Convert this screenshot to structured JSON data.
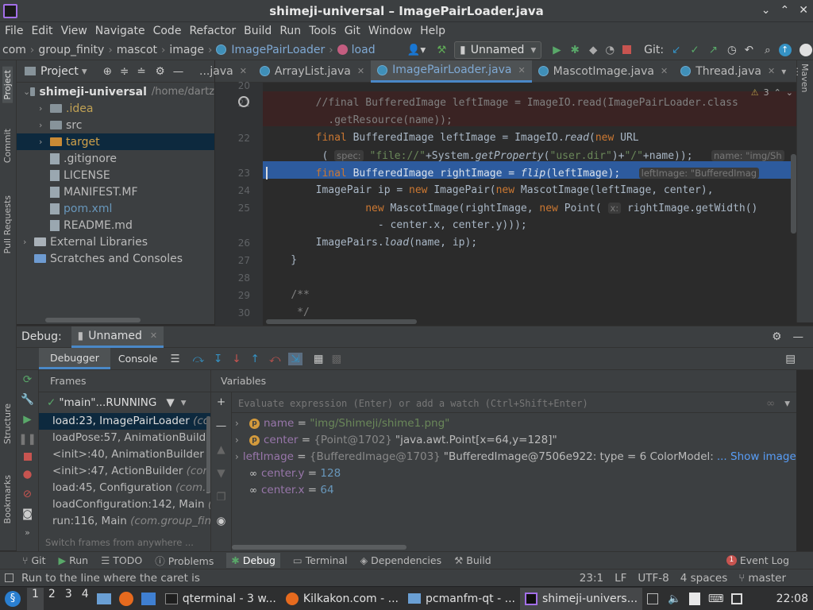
{
  "window": {
    "title": "shimeji-universal – ImagePairLoader.java"
  },
  "menu": [
    "File",
    "Edit",
    "View",
    "Navigate",
    "Code",
    "Refactor",
    "Build",
    "Run",
    "Tools",
    "Git",
    "Window",
    "Help"
  ],
  "nav": {
    "crumbs": [
      "com",
      "group_finity",
      "mascot",
      "image",
      "ImagePairLoader",
      "load"
    ],
    "run_config": "Unnamed",
    "git_label": "Git:"
  },
  "left_stripe": [
    "Project",
    "Commit",
    "Pull Requests",
    "Structure",
    "Bookmarks"
  ],
  "right_stripe": [
    "Maven"
  ],
  "project": {
    "header": "Project",
    "tree": [
      {
        "name": "shimeji-universal",
        "suffix": "/home/dartz",
        "level": 0,
        "kind": "folder",
        "bold": true,
        "expanded": true
      },
      {
        "name": ".idea",
        "level": 1,
        "kind": "folder",
        "color": "#c0a154"
      },
      {
        "name": "src",
        "level": 1,
        "kind": "folder"
      },
      {
        "name": "target",
        "level": 1,
        "kind": "folder-orange",
        "color": "#d0a14a",
        "selected": true
      },
      {
        "name": ".gitignore",
        "level": 1,
        "kind": "file"
      },
      {
        "name": "LICENSE",
        "level": 1,
        "kind": "file"
      },
      {
        "name": "MANIFEST.MF",
        "level": 1,
        "kind": "file"
      },
      {
        "name": "pom.xml",
        "level": 1,
        "kind": "file",
        "color": "#6897bb"
      },
      {
        "name": "README.md",
        "level": 1,
        "kind": "file"
      },
      {
        "name": "External Libraries",
        "level": 0,
        "kind": "lib"
      },
      {
        "name": "Scratches and Consoles",
        "level": 0,
        "kind": "scratch"
      }
    ]
  },
  "editor": {
    "tabs": [
      {
        "label": "...java",
        "active": false
      },
      {
        "label": "ArrayList.java",
        "active": false
      },
      {
        "label": "ImagePairLoader.java",
        "active": true
      },
      {
        "label": "MascotImage.java",
        "active": false
      },
      {
        "label": "Thread.java",
        "active": false
      }
    ],
    "warnings": "3",
    "lines": [
      {
        "num": "20",
        "html": ""
      },
      {
        "num": "21",
        "html": "        <span class='cm'>//final BufferedImage leftImage = ImageIO.read(ImagePairLoader.class</span>"
      },
      {
        "num": "",
        "html": "          <span class='cm'>.getResource(name));</span>"
      },
      {
        "num": "22",
        "html": "        <span class='kw'>final</span> BufferedImage leftImage = ImageIO.<span class='it'>read</span>(<span class='kw'>new</span> URL"
      },
      {
        "num": "",
        "html": "         ( <span class='hint'>spec:</span> <span class='str'>\"file://\"</span>+System.<span class='it'>getProperty</span>(<span class='str'>\"user.dir\"</span>)+<span class='str'>\"/\"</span>+name));   <span class='hint'>name: \"img/Sh</span>"
      },
      {
        "num": "23",
        "html": "        <span class='kw'>final</span> BufferedImage rightImage = <span class='it'>flip</span>(leftImage);   <span class='hint'>leftImage: \"BufferedImag</span>"
      },
      {
        "num": "24",
        "html": "        ImagePair ip = <span class='kw'>new</span> ImagePair(<span class='kw'>new</span> MascotImage(leftImage, center),"
      },
      {
        "num": "25",
        "html": "                <span class='kw'>new</span> MascotImage(rightImage, <span class='kw'>new</span> Point( <span class='hint'>x:</span> rightImage.getWidth()"
      },
      {
        "num": "",
        "html": "                  - center.x, center.y)));"
      },
      {
        "num": "26",
        "html": "        ImagePairs.<span class='it'>load</span>(name, ip);"
      },
      {
        "num": "27",
        "html": "    }"
      },
      {
        "num": "28",
        "html": ""
      },
      {
        "num": "29",
        "html": "    <span class='cm'>/**</span>"
      },
      {
        "num": "30",
        "html": "     <span class='cm'>*/</span>"
      }
    ]
  },
  "debug": {
    "label": "Debug:",
    "session": "Unnamed",
    "tabs": [
      "Debugger",
      "Console"
    ],
    "frames_header": "Frames",
    "thread": "\"main\"...RUNNING",
    "frames": [
      {
        "method": "load:23, ImagePairLoader",
        "pkg": "(com",
        "selected": true
      },
      {
        "method": "loadPose:57, AnimationBuilder",
        "pkg": ""
      },
      {
        "method": "<init>:40, AnimationBuilder",
        "pkg": "(c"
      },
      {
        "method": "<init>:47, ActionBuilder",
        "pkg": "(com."
      },
      {
        "method": "load:45, Configuration",
        "pkg": "(com.gr"
      },
      {
        "method": "loadConfiguration:142, Main",
        "pkg": "(c"
      },
      {
        "method": "run:116, Main",
        "pkg": "(com.group_finit"
      }
    ],
    "switch_frames": "Switch frames from anywhere ...",
    "variables_header": "Variables",
    "evaluate_placeholder": "Evaluate expression (Enter) or add a watch (Ctrl+Shift+Enter)",
    "variables": [
      {
        "badge": "p",
        "name": "name",
        "eq": " = ",
        "value": "\"img/Shimeji/shime1.png\"",
        "value_color": "#6a8759",
        "expandable": true
      },
      {
        "badge": "p",
        "name": "center",
        "eq": " = ",
        "type": "{Point@1702}",
        "value": "\"java.awt.Point[x=64,y=128]\"",
        "value_color": "#bbbbbb",
        "expandable": true
      },
      {
        "badge": "f",
        "name": "leftImage",
        "eq": " = ",
        "type": "{BufferedImage@1703}",
        "value": "\"BufferedImage@7506e922: type = 6 ColorModel:",
        "value_color": "#bbbbbb",
        "link": "... Show image",
        "expandable": true
      },
      {
        "badge": "oo",
        "name": "center.y",
        "eq": " = ",
        "value": "128",
        "value_color": "#6897bb"
      },
      {
        "badge": "oo",
        "name": "center.x",
        "eq": " = ",
        "value": "64",
        "value_color": "#6897bb"
      }
    ]
  },
  "toolwindows": [
    "Git",
    "Run",
    "TODO",
    "Problems",
    "Debug",
    "Terminal",
    "Dependencies",
    "Build"
  ],
  "event_log": {
    "count": "1",
    "label": "Event Log"
  },
  "status": {
    "message": "Run to the line where the caret is",
    "position": "23:1",
    "line_sep": "LF",
    "encoding": "UTF-8",
    "indent": "4 spaces",
    "branch": "master"
  },
  "taskbar": {
    "workspaces": [
      "1",
      "2",
      "3",
      "4"
    ],
    "tasks": [
      "qterminal - 3 w...",
      "Kilkakon.com - ...",
      "pcmanfm-qt - ...",
      "shimeji-univers..."
    ],
    "clock": "22:08"
  }
}
